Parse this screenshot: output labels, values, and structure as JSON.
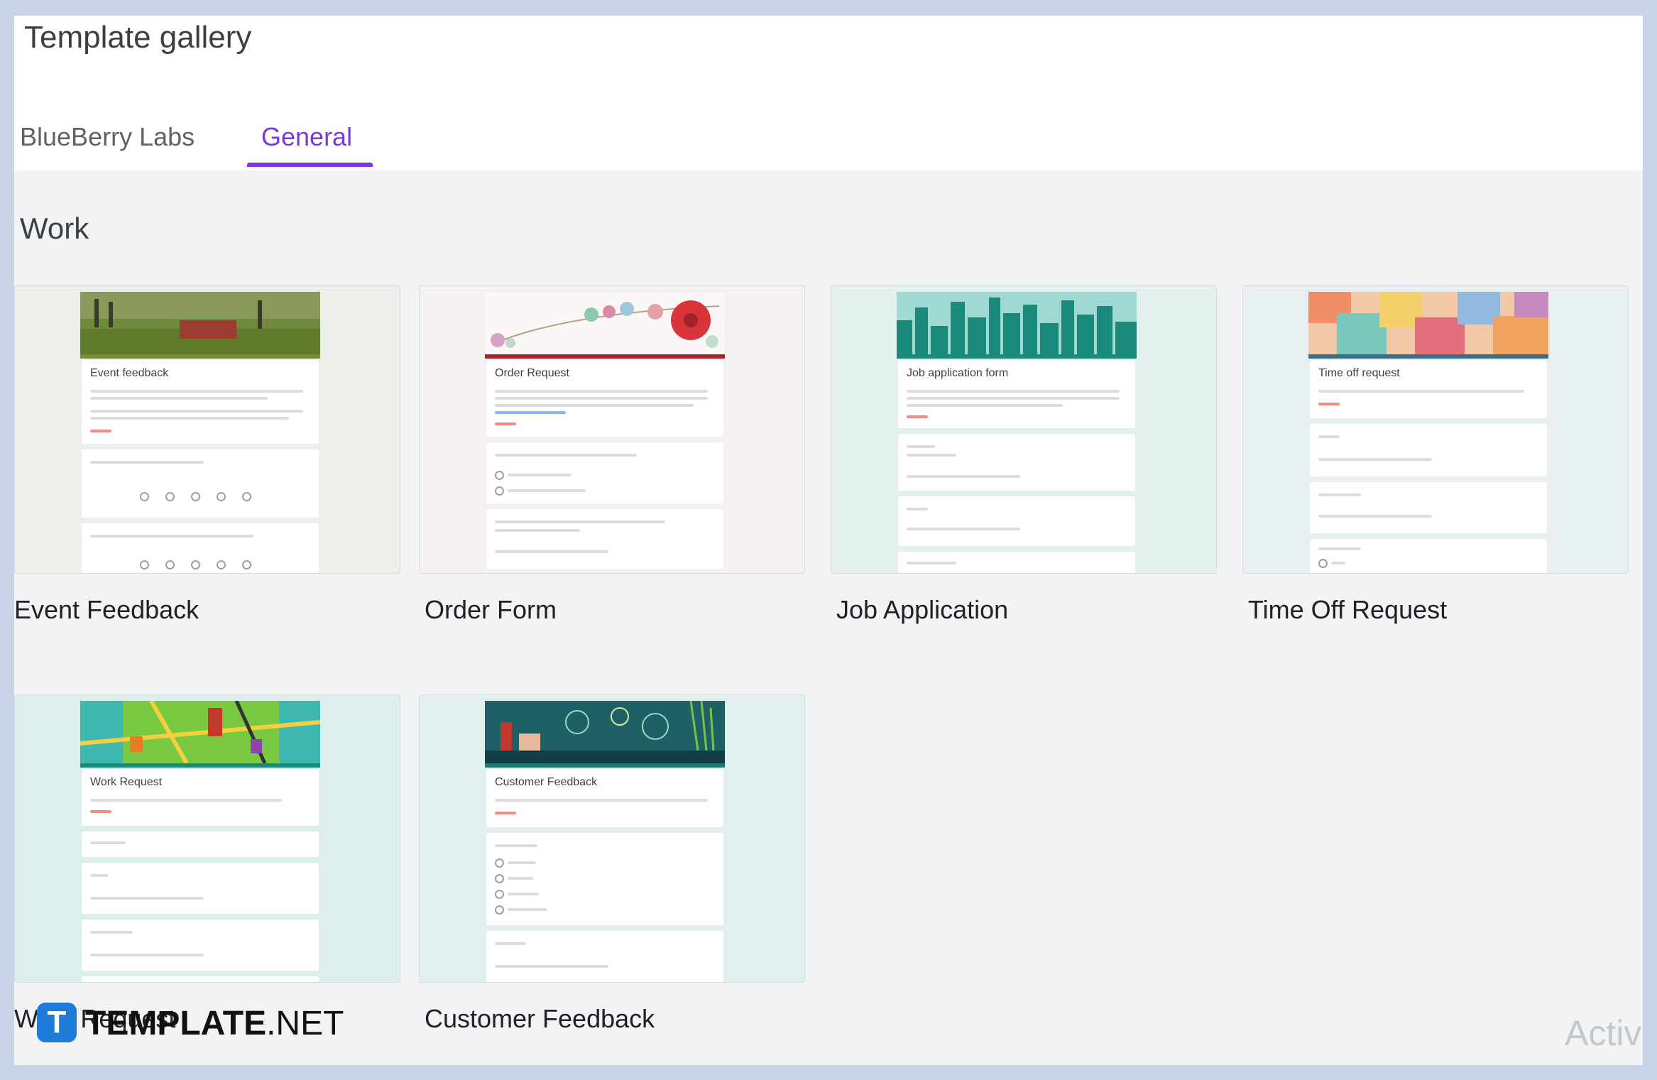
{
  "header": {
    "title": "Template gallery",
    "tabs": [
      {
        "label": "BlueBerry Labs",
        "active": false
      },
      {
        "label": "General",
        "active": true
      }
    ],
    "accent_color": "#7b39d8"
  },
  "section": {
    "label": "Work"
  },
  "templates": [
    {
      "title": "Event Feedback",
      "form_heading": "Event feedback"
    },
    {
      "title": "Order Form",
      "form_heading": "Order Request"
    },
    {
      "title": "Job Application",
      "form_heading": "Job application form"
    },
    {
      "title": "Time Off Request",
      "form_heading": "Time off request"
    },
    {
      "title": "Work Request",
      "form_heading": "Work Request"
    },
    {
      "title": "Customer Feedback",
      "form_heading": "Customer Feedback"
    }
  ],
  "watermark": {
    "logo_letter": "T",
    "logo_word_bold": "TEMPLATE",
    "logo_word_regular": ".NET",
    "os_notice": "Activa"
  }
}
